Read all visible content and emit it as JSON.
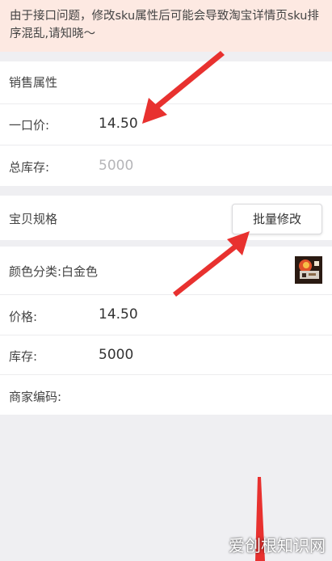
{
  "notice": {
    "text": "由于接口问题，修改sku属性后可能会导致淘宝详情页sku排序混乱,请知晓～"
  },
  "sales": {
    "section_title": "销售属性",
    "price_label": "一口价:",
    "price_value": "14.50",
    "stock_label": "总库存:",
    "stock_value": "5000"
  },
  "spec": {
    "section_title": "宝贝规格",
    "batch_button": "批量修改"
  },
  "sku": {
    "color_label": "颜色分类:白金色",
    "price_label": "价格:",
    "price_value": "14.50",
    "stock_label": "库存:",
    "stock_value": "5000",
    "code_label": "商家编码:",
    "code_value": ""
  },
  "watermark": "爱创根知识网",
  "colors": {
    "notice_bg": "#fde9e2",
    "page_bg": "#efeff2",
    "arrow": "#e8312f"
  }
}
